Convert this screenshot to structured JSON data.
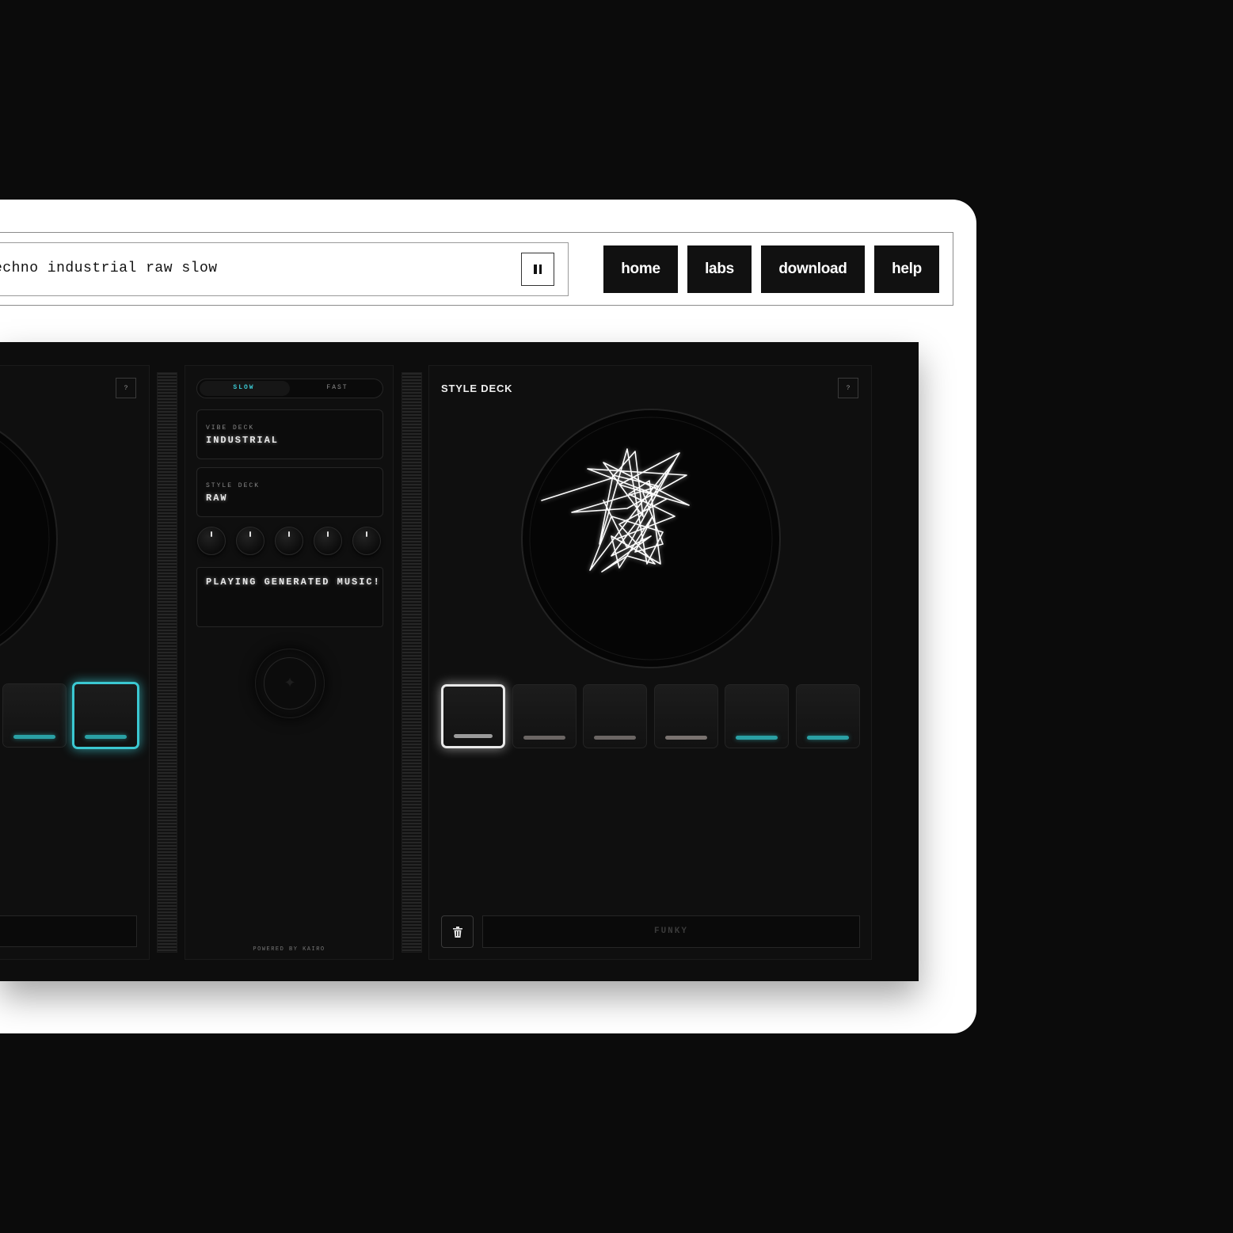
{
  "prompt": {
    "value": "echno industrial raw slow"
  },
  "nav": {
    "home": "home",
    "labs": "labs",
    "download": "download",
    "help": "help"
  },
  "left_deck": {
    "help_label": "?"
  },
  "mixer": {
    "tempo_slow": "SLOW",
    "tempo_fast": "FAST",
    "vibe_label": "VIBE DECK",
    "vibe_value": "INDUSTRIAL",
    "style_label": "STYLE DECK",
    "style_value": "RAW",
    "status": "PLAYING GENERATED MUSIC!",
    "powered_by": "POWERED BY KAIRO",
    "knob_count": 5,
    "center_icon": "sparkle-icon"
  },
  "style_deck": {
    "title": "STYLE DECK",
    "help_label": "?",
    "input_placeholder": "FUNKY",
    "delete_icon": "trash-icon"
  },
  "colors": {
    "accent_teal": "#3bc8d2",
    "led_grey": "#6b6664",
    "background": "#0b0b0b"
  }
}
